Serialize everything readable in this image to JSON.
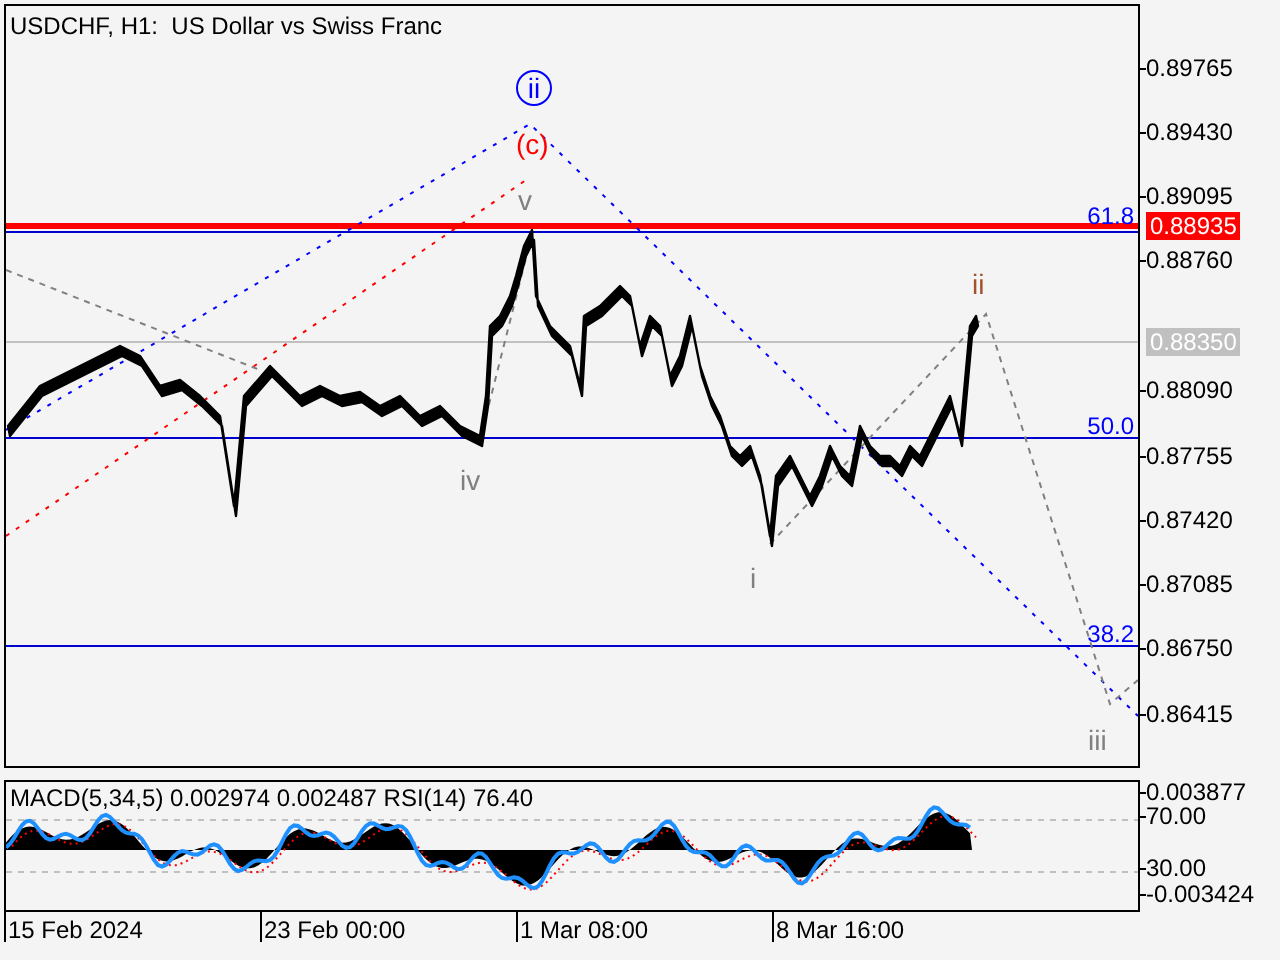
{
  "chart": {
    "title": "USDCHF, H1:  US Dollar vs Swiss Franc",
    "wave_labels": [
      {
        "text": "ii",
        "kind": "circled",
        "color": "#0000ff"
      },
      {
        "text": "(c)",
        "kind": "plain",
        "color": "#ff0000"
      },
      {
        "text": "v",
        "kind": "plain",
        "color": "#808080"
      },
      {
        "text": "iv",
        "kind": "plain",
        "color": "#808080"
      },
      {
        "text": "i",
        "kind": "plain",
        "color": "#808080"
      },
      {
        "text": "ii",
        "kind": "plain",
        "color": "#a0522d"
      },
      {
        "text": "iii",
        "kind": "plain",
        "color": "#808080"
      }
    ],
    "fib_levels": [
      "61.8",
      "50.0",
      "38.2"
    ]
  },
  "price_axis": [
    "0.89765",
    "0.89430",
    "0.89095",
    "0.88760",
    "0.88090",
    "0.87755",
    "0.87420",
    "0.87085",
    "0.86750",
    "0.86415"
  ],
  "price_tags": [
    {
      "text": "0.88935",
      "color": "#ff0000"
    },
    {
      "text": "0.88350",
      "color": "#c0c0c0"
    }
  ],
  "indicator": {
    "title": "MACD(5,34,5) 0.002974 0.002487 RSI(14) 76.40",
    "axis": [
      "0.003877",
      "70.00",
      "30.00",
      "-0.003424"
    ]
  },
  "time_axis": [
    "15 Feb 2024",
    "23 Feb 00:00",
    "1 Mar 08:00",
    "8 Mar 16:00"
  ]
}
